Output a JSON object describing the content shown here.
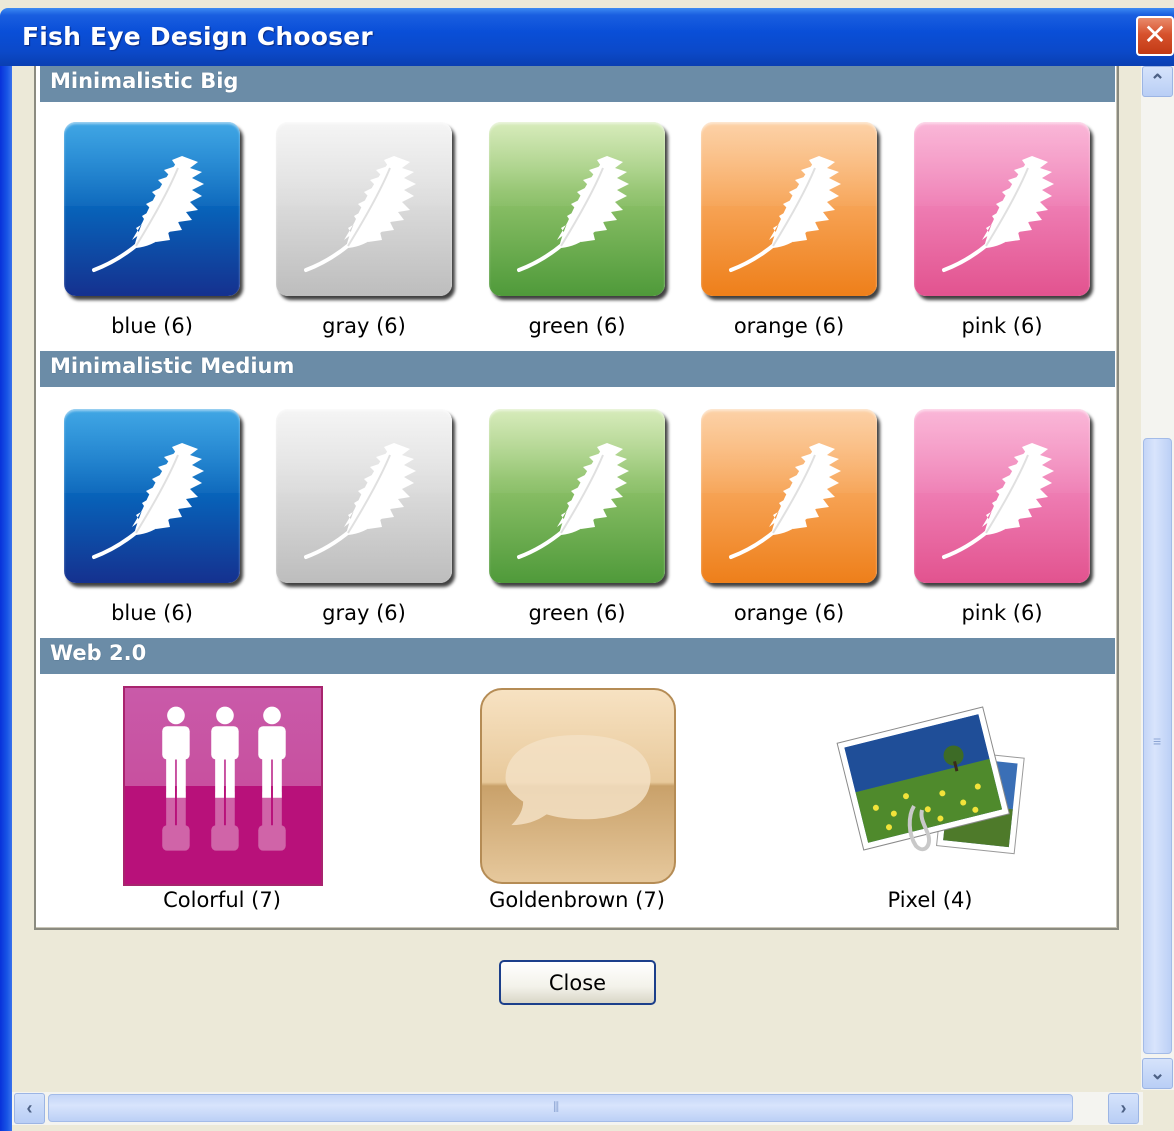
{
  "window": {
    "title": "Fish Eye Design Chooser",
    "close_glyph": "✕"
  },
  "sections": [
    {
      "title": "Minimalistic Big",
      "items": [
        {
          "label": "blue (6)",
          "color": "#0667bd"
        },
        {
          "label": "gray (6)",
          "color": "#d9d9d9"
        },
        {
          "label": "green (6)",
          "color": "#8fc26a"
        },
        {
          "label": "orange (6)",
          "color": "#f7a558"
        },
        {
          "label": "pink (6)",
          "color": "#ef7fb5"
        }
      ]
    },
    {
      "title": "Minimalistic Medium",
      "items": [
        {
          "label": "blue (6)",
          "color": "#0667bd"
        },
        {
          "label": "gray (6)",
          "color": "#d9d9d9"
        },
        {
          "label": "green (6)",
          "color": "#8fc26a"
        },
        {
          "label": "orange (6)",
          "color": "#f7a558"
        },
        {
          "label": "pink (6)",
          "color": "#ef7fb5"
        }
      ]
    },
    {
      "title": "Web 2.0",
      "items": [
        {
          "label": "Colorful (7)",
          "icon": "people-icon",
          "color": "#c8509f"
        },
        {
          "label": "Goldenbrown (7)",
          "icon": "speech-bubble-icon",
          "color": "#e8c99b"
        },
        {
          "label": "Pixel (4)",
          "icon": "photos-icon"
        }
      ]
    }
  ],
  "footer": {
    "close_label": "Close"
  },
  "scrollbars": {
    "up_arrow": "⌃",
    "down_arrow": "⌄",
    "left_arrow": "‹",
    "right_arrow": "›"
  }
}
